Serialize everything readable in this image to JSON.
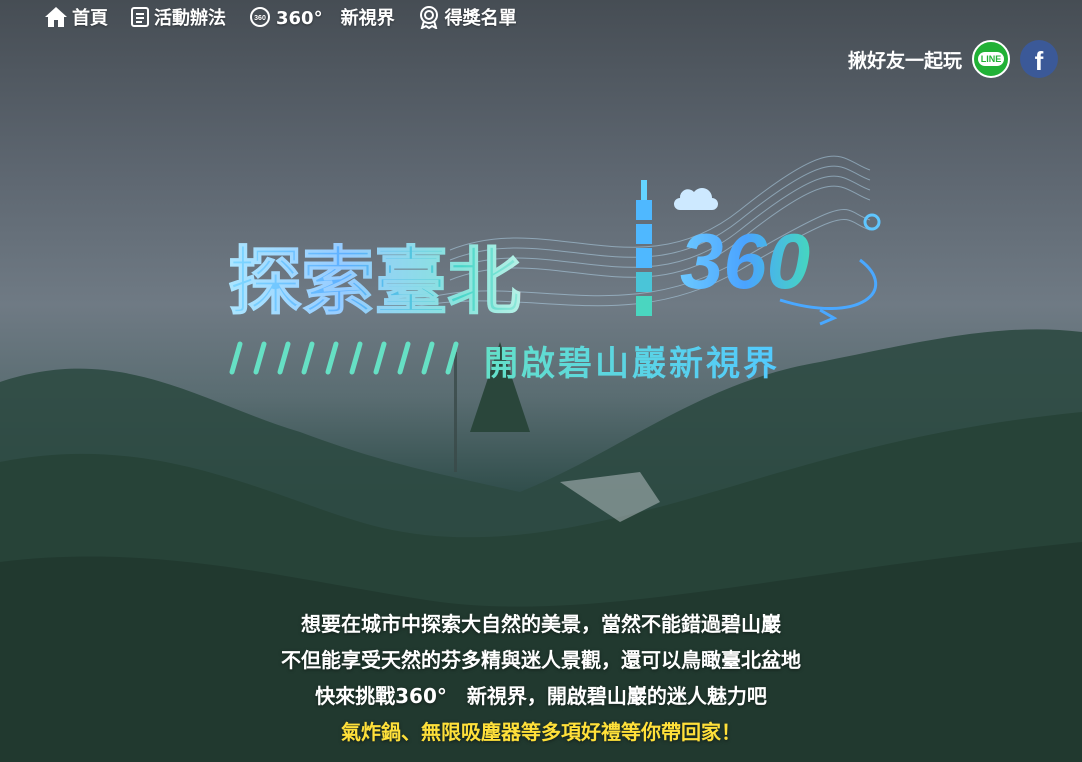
{
  "nav": {
    "items": [
      {
        "label": "首頁",
        "icon": "home-icon"
      },
      {
        "label": "活動辦法",
        "icon": "document-icon"
      },
      {
        "label": "360°　新視界",
        "icon": "360-icon"
      },
      {
        "label": "得獎名單",
        "icon": "award-icon"
      }
    ]
  },
  "share": {
    "label": "揪好友一起玩",
    "line_text": "LINE",
    "facebook_text": "f"
  },
  "logo": {
    "title": "探索臺北",
    "number": "360",
    "subtitle": "開啟碧山巖新視界"
  },
  "intro": {
    "lines": [
      "想要在城市中探索大自然的美景，當然不能錯過碧山巖",
      "不但能享受天然的芬多精與迷人景觀，還可以鳥瞰臺北盆地",
      "快來挑戰360°　新視界，開啟碧山巖的迷人魅力吧"
    ],
    "highlight": "氣炸鍋、無限吸塵器等多項好禮等你帶回家！"
  },
  "colors": {
    "accent_yellow": "#ffe03a",
    "line_green": "#21b136",
    "facebook_blue": "#3b5998"
  }
}
